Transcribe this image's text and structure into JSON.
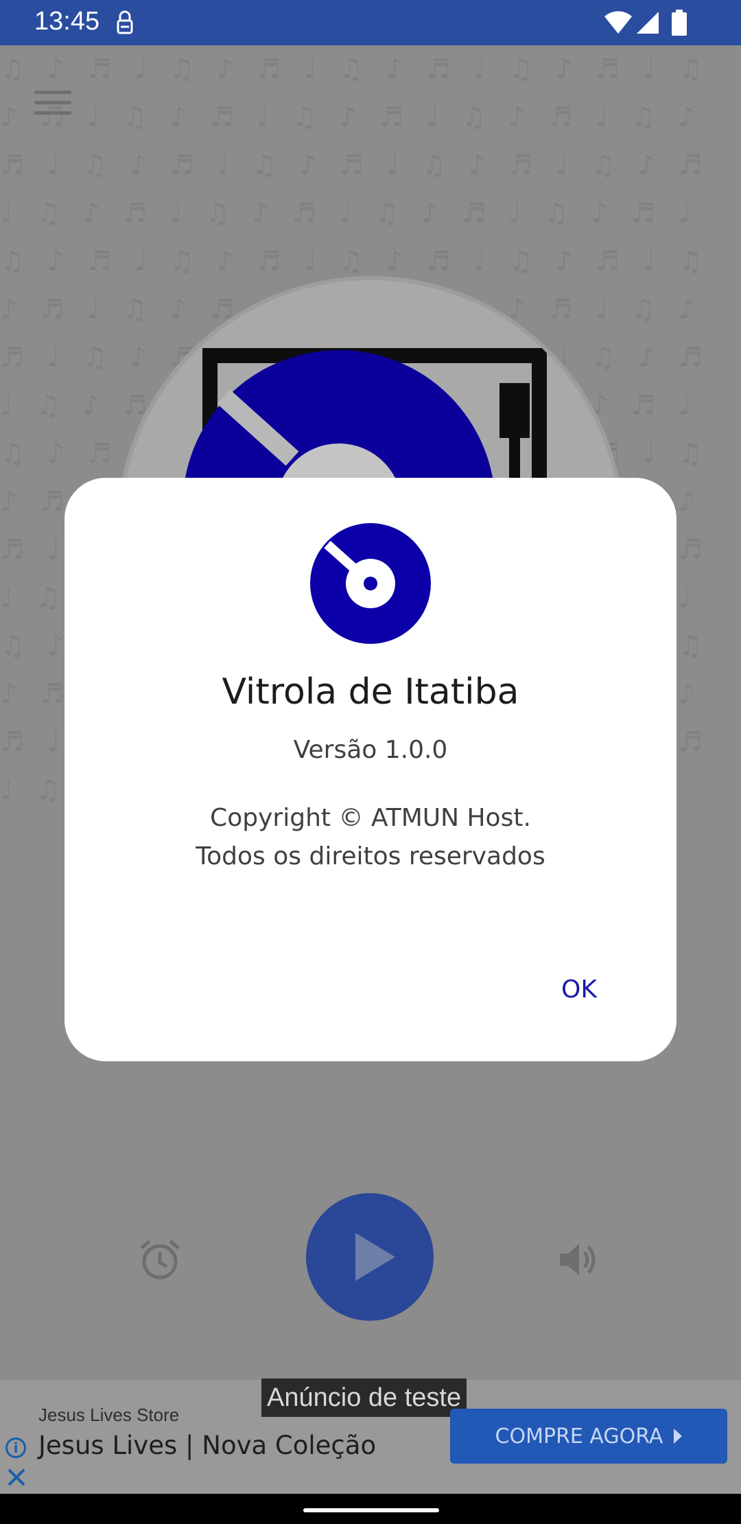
{
  "status_bar": {
    "time": "13:45"
  },
  "app": {
    "background_pattern": "♫ ♪ ♬ ♩ ♫ ♪ ♬ ♩ ♫ ♪ ♬ ♩ ♫ ♪ ♬ ♩ ♫ ♪ ♬ ♩ ♫ ♪ ♬ ♩ ♫ ♪ ♬ ♩ ♫ ♪ ♬ ♩ ♫ ♪ ♬ ♩ ♫ ♪ ♬ ♩ ♫ ♪ ♬ ♩ ♫ ♪ ♬ ♩ ♫ ♪ ♬ ♩ ♫ ♪ ♬ ♩ ♫ ♪ ♬ ♩ ♫ ♪ ♬ ♩ ♫ ♪ ♬ ♩ ♫ ♪ ♬ ♩ ♫ ♪ ♬ ♩ ♫ ♪ ♬ ♩ ♫ ♪ ♬ ♩ ♫ ♪ ♬ ♩ ♫ ♪ ♬ ♩ ♫ ♪ ♬ ♩ ♫ ♪ ♬ ♩ ♫ ♪ ♬ ♩ ♫ ♪ ♬ ♩ ♫ ♪ ♬ ♩ ♫ ♪ ♬ ♩ ♫ ♪ ♬ ♩ ♫ ♪ ♬ ♩ ♫ ♪ ♬ ♩ ♫ ♪ ♬ ♩ ♫ ♪ ♬ ♩ ♫ ♪ ♬ ♩ ♫ ♪ ♬ ♩ ♫ ♪ ♬ ♩ ♫ ♪ ♬ ♩ ♫ ♪ ♬ ♩ ♫ ♪ ♬ ♩ ♫ ♪ ♬ ♩ ♫ ♪ ♬ ♩ ♫ ♪ ♬ ♩ ♫ ♪ ♬ ♩ ♫ ♪ ♬ ♩ ♫ ♪ ♬ ♩ ♫ ♪ ♬ ♩ ♫ ♪ ♬ ♩ ♫ ♪ ♬ ♩ ♫ ♪ ♬ ♩ ♫ ♪ ♬ ♩ ♫ ♪ ♬ ♩ ♫ ♪ ♬ ♩ ♫ ♪ ♬ ♩ ♫ ♪ ♬ ♩ ♫ ♪ ♬ ♩ ♫ ♪ ♬ ♩ ♫ ♪ ♬ ♩ ♫ ♪ ♬ ♩ ♫ ♪ ♬ ♩ ♫ ♪ ♬ ♩ ♫ ♪ ♬ ♩ ♫ ♪ ♬ ♩ ♫ ♪ ♬ ♩ ♫ ♪ ♬ ♩",
    "icons": [
      "menu-icon",
      "turntable-icon",
      "alarm-icon",
      "play-icon",
      "volume-icon"
    ]
  },
  "dialog": {
    "title": "Vitrola de Itatiba",
    "version": "Versão 1.0.0",
    "copyright_line1": "Copyright © ATMUN Host.",
    "copyright_line2": "Todos os direitos reservados",
    "ok_label": "OK"
  },
  "ad": {
    "tag": "Anúncio de teste",
    "store": "Jesus Lives Store",
    "title": "Jesus Lives | Nova Coleção",
    "cta": "COMPRE AGORA"
  },
  "colors": {
    "status_bar": "#2a4d9f",
    "accent_blue": "#0c00a8",
    "cta_blue": "#2258b6",
    "ok_text": "#1a1aa8"
  }
}
